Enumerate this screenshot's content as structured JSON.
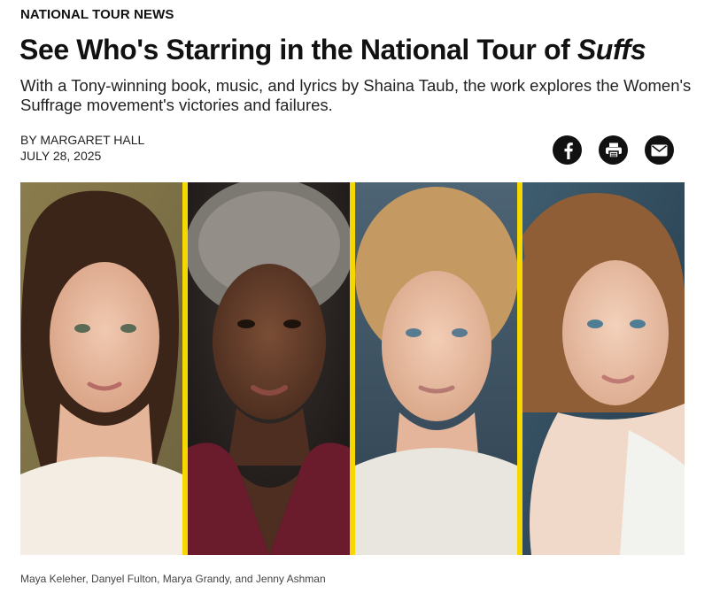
{
  "article": {
    "category": "NATIONAL TOUR NEWS",
    "headline_main": "See Who's Starring in the National Tour of ",
    "headline_italic": "Suffs",
    "subhead": "With a Tony-winning book, music, and lyrics by Shaina Taub, the work explores the Women's Suffrage movement's victories and failures.",
    "byline": "BY MARGARET HALL",
    "date": "JULY 28, 2025",
    "caption": "Maya Keleher, Danyel Fulton, Marya Grandy, and Jenny Ashman"
  },
  "share": {
    "icons": [
      "facebook-icon",
      "print-icon",
      "email-icon"
    ]
  },
  "colors": {
    "divider": "#f5d800",
    "button_bg": "#111111"
  }
}
